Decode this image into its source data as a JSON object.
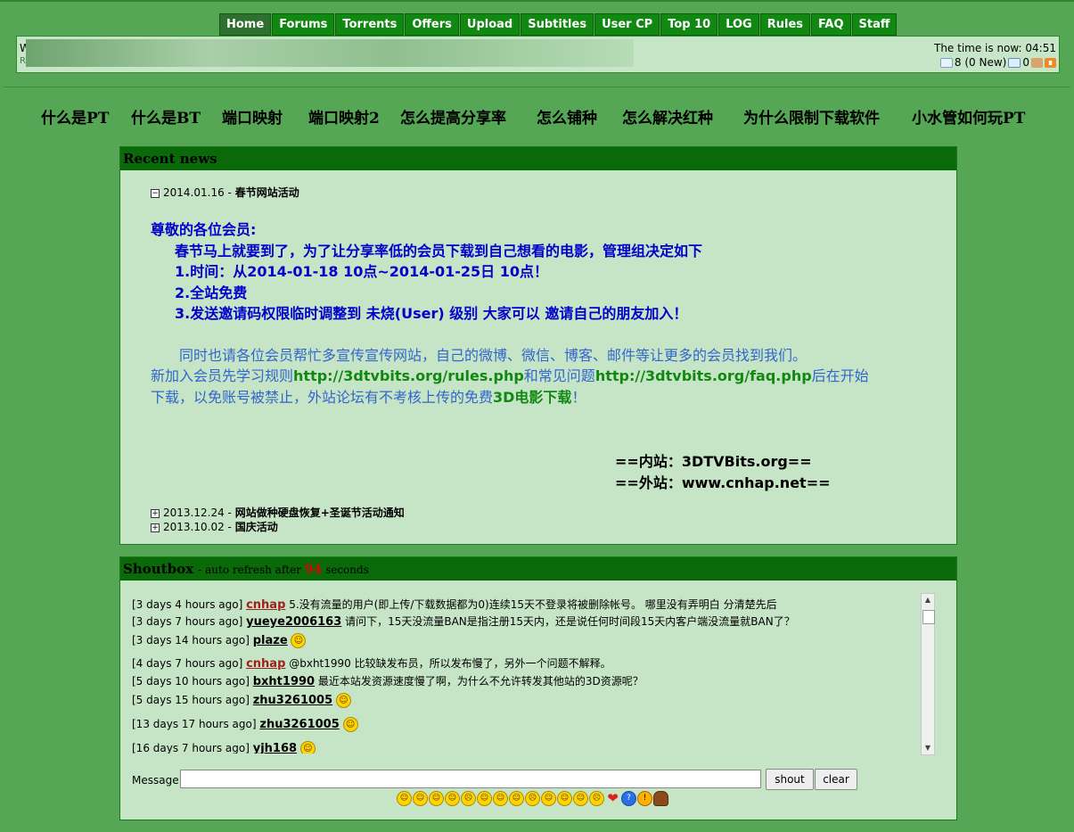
{
  "nav": [
    {
      "label": "Home",
      "active": true
    },
    {
      "label": "Forums"
    },
    {
      "label": "Torrents"
    },
    {
      "label": "Offers"
    },
    {
      "label": "Upload"
    },
    {
      "label": "Subtitles"
    },
    {
      "label": "User CP"
    },
    {
      "label": "Top 10"
    },
    {
      "label": "LOG"
    },
    {
      "label": "Rules"
    },
    {
      "label": "FAQ"
    },
    {
      "label": "Staff"
    }
  ],
  "info": {
    "time_text": "The time is now: 04:51",
    "messages": "8 (0 New)",
    "broadcast_count": "0",
    "user_stub_initial": "W",
    "user_stub_second": "R"
  },
  "links": [
    "什么是PT",
    "什么是BT",
    "端口映射",
    "端口映射2",
    "怎么提高分享率",
    "怎么铺种",
    "怎么解决红种",
    "为什么限制下载软件",
    "小水管如何玩PT"
  ],
  "news": {
    "title": "Recent news",
    "items": [
      {
        "date": "2014.01.16",
        "title": "春节网站活动",
        "expanded": true
      },
      {
        "date": "2013.12.24",
        "title": "网站做种硬盘恢复+圣诞节活动通知",
        "expanded": false
      },
      {
        "date": "2013.10.02",
        "title": "国庆活动",
        "expanded": false
      }
    ],
    "body": {
      "greeting": "尊敬的各位会员:",
      "line1": "春节马上就要到了，为了让分享率低的会员下载到自己想看的电影，管理组决定如下",
      "line2": "1.时间：从2014-01-18 10点~2014-01-25日 10点！",
      "line3": "2.全站免费",
      "line4": "3.发送邀请码权限临时调整到 未烧(User) 级别 大家可以 邀请自己的朋友加入！",
      "para1": "同时也请各位会员帮忙多宣传宣传网站，自己的微博、微信、博客、邮件等让更多的会员找到我们。",
      "para2a": "新加入会员先学习规则",
      "rules_url": "http://3dtvbits.org/rules.php",
      "para2b": "和常见问题",
      "faq_url": "http://3dtvbits.org/faq.php",
      "para2c": "后在开始",
      "para3a": "下载，以免账号被禁止，外站论坛有不考核上传的免费",
      "para3b": "3D电影下载",
      "para3c": "！",
      "sig1": "==内站：3DTVBits.org==",
      "sig2": "==外站：www.cnhap.net=="
    }
  },
  "shoutbox": {
    "title": "Shoutbox",
    "refresh_pre": "- auto refresh after",
    "refresh_seconds": "94",
    "refresh_post": "seconds",
    "rows": [
      {
        "time": "[3 days 4 hours ago]",
        "user": "cnhap",
        "staff": true,
        "text": "5.没有流量的用户(即上传/下载数据都为0)连续15天不登录将被删除帐号。 哪里没有弄明白 分清楚先后",
        "smile": false
      },
      {
        "time": "[3 days 7 hours ago]",
        "user": "yueye2006163",
        "staff": false,
        "text": "请问下，15天没流量BAN是指注册15天内，还是说任何时间段15天内客户端没流量就BAN了？",
        "smile": false
      },
      {
        "time": "[3 days 14 hours ago]",
        "user": "plaze",
        "staff": false,
        "text": "",
        "smile": true
      },
      {
        "time": "[4 days 7 hours ago]",
        "user": "cnhap",
        "staff": true,
        "text": "@bxht1990  比较缺发布员，所以发布慢了，另外一个问题不解释。",
        "smile": false
      },
      {
        "time": "[5 days 10 hours ago]",
        "user": "bxht1990",
        "staff": false,
        "text": "最近本站发资源速度慢了啊，为什么不允许转发其他站的3D资源呢？",
        "smile": false
      },
      {
        "time": "[5 days 15 hours ago]",
        "user": "zhu3261005",
        "staff": false,
        "text": "",
        "smile": true
      },
      {
        "time": "[13 days 17 hours ago]",
        "user": "zhu3261005",
        "staff": false,
        "text": "",
        "smile": true
      },
      {
        "time": "[16 days 7 hours ago]",
        "user": "yjh168",
        "staff": false,
        "text": "",
        "smile": true
      }
    ],
    "message_label": "Message:",
    "shout_label": "shout",
    "clear_label": "clear"
  }
}
